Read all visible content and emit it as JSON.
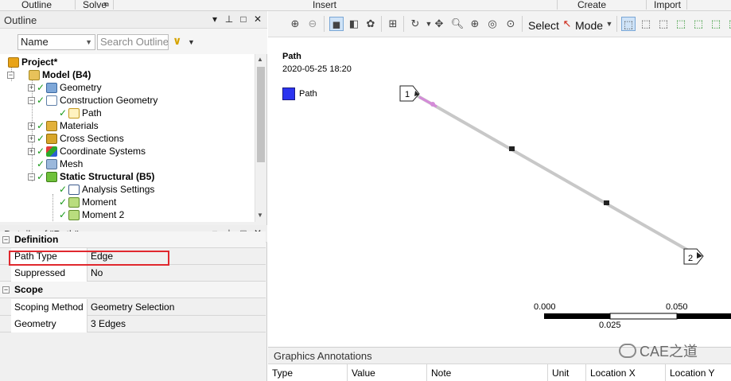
{
  "ribbon": {
    "groups": [
      "Outline",
      "Solve",
      "Insert",
      "Create",
      "Import"
    ]
  },
  "outline": {
    "title": "Outline",
    "name_selector": "Name",
    "search_placeholder": "Search Outline",
    "tree": [
      {
        "label": "Project*",
        "bold": true
      },
      {
        "label": "Model (B4)",
        "bold": true
      },
      {
        "label": "Geometry"
      },
      {
        "label": "Construction Geometry"
      },
      {
        "label": "Path"
      },
      {
        "label": "Materials"
      },
      {
        "label": "Cross Sections"
      },
      {
        "label": "Coordinate Systems"
      },
      {
        "label": "Mesh"
      },
      {
        "label": "Static Structural (B5)",
        "bold": true
      },
      {
        "label": "Analysis Settings"
      },
      {
        "label": "Moment"
      },
      {
        "label": "Moment 2"
      }
    ]
  },
  "details": {
    "title": "Details of \"Path\"",
    "sections": [
      {
        "name": "Definition",
        "rows": [
          {
            "key": "Path Type",
            "value": "Edge"
          },
          {
            "key": "Suppressed",
            "value": "No"
          }
        ]
      },
      {
        "name": "Scope",
        "rows": [
          {
            "key": "Scoping Method",
            "value": "Geometry Selection"
          },
          {
            "key": "Geometry",
            "value": "3 Edges"
          }
        ]
      }
    ]
  },
  "graphics_toolbar": {
    "select_label": "Select",
    "mode_label": "Mode"
  },
  "graphics": {
    "title": "Path",
    "date": "2020-05-25 18:20",
    "legend_label": "Path",
    "legend_color": "#2b34f0",
    "start_marker": "1",
    "end_marker": "2",
    "scale": {
      "left": "0.000",
      "mid": "0.025",
      "right": "0.050"
    }
  },
  "annotations": {
    "title": "Graphics Annotations",
    "columns": [
      "Type",
      "Value",
      "Note",
      "Unit",
      "Location X",
      "Location Y"
    ]
  },
  "watermark": "CAE之道"
}
